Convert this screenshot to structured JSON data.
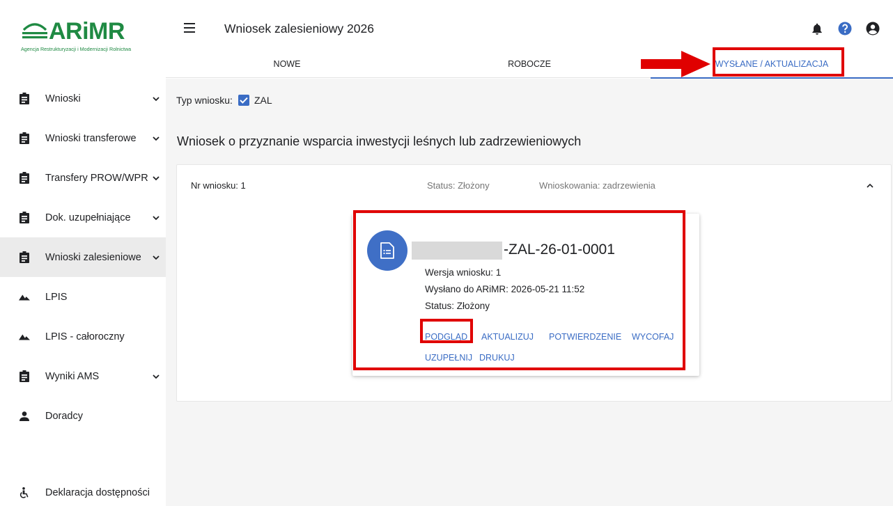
{
  "brand": {
    "name": "ARiMR",
    "subtitle": "Agencja Restrukturyzacji i Modernizacji Rolnictwa",
    "color": "#1f8a43"
  },
  "sidebar": {
    "items": [
      {
        "label": "Wnioski",
        "icon": "clipboard-icon",
        "has_chevron": true
      },
      {
        "label": "Wnioski transferowe",
        "icon": "clipboard-icon",
        "has_chevron": true
      },
      {
        "label": "Transfery PROW/WPR",
        "icon": "clipboard-icon",
        "has_chevron": true
      },
      {
        "label": "Dok. uzupełniające",
        "icon": "clipboard-icon",
        "has_chevron": true
      },
      {
        "label": "Wnioski zalesieniowe",
        "icon": "clipboard-icon",
        "has_chevron": true,
        "active": true
      },
      {
        "label": "LPIS",
        "icon": "terrain-icon",
        "has_chevron": false
      },
      {
        "label": "LPIS - całoroczny",
        "icon": "terrain-icon",
        "has_chevron": false
      },
      {
        "label": "Wyniki AMS",
        "icon": "clipboard-icon",
        "has_chevron": true
      },
      {
        "label": "Doradcy",
        "icon": "person-icon",
        "has_chevron": false
      }
    ],
    "footer": {
      "label": "Deklaracja dostępności",
      "icon": "accessibility-icon"
    }
  },
  "header": {
    "title": "Wniosek zalesieniowy 2026",
    "icons": [
      "bell-icon",
      "help-icon",
      "account-icon"
    ]
  },
  "tabs": [
    {
      "label": "NOWE",
      "active": false
    },
    {
      "label": "ROBOCZE",
      "active": false
    },
    {
      "label": "WYSŁANE / AKTUALIZACJA",
      "active": true
    }
  ],
  "filter": {
    "label": "Typ wniosku:",
    "checkbox_label": "ZAL",
    "checked": true
  },
  "section_title": "Wniosek o przyznanie wsparcia inwestycji leśnych lub zadrzewieniowych",
  "panel": {
    "nr": "Nr wniosku: 1",
    "status": "Status: Złożony",
    "type": "Wnioskowania: zadrzewienia"
  },
  "card": {
    "id_suffix": "-ZAL-26-01-0001",
    "version": "Wersja wniosku: 1",
    "sent": "Wysłano do ARiMR: 2026-05-21 11:52",
    "status": "Status: Złożony",
    "actions_row1": [
      "PODGLĄD",
      "AKTUALIZUJ",
      "POTWIERDZENIE",
      "WYCOFAJ"
    ],
    "actions_row2": [
      "UZUPEŁNIJ",
      "DRUKUJ"
    ]
  },
  "colors": {
    "accent": "#3a6cc4",
    "highlight": "#e00000",
    "avatar": "#3f6fc6"
  }
}
